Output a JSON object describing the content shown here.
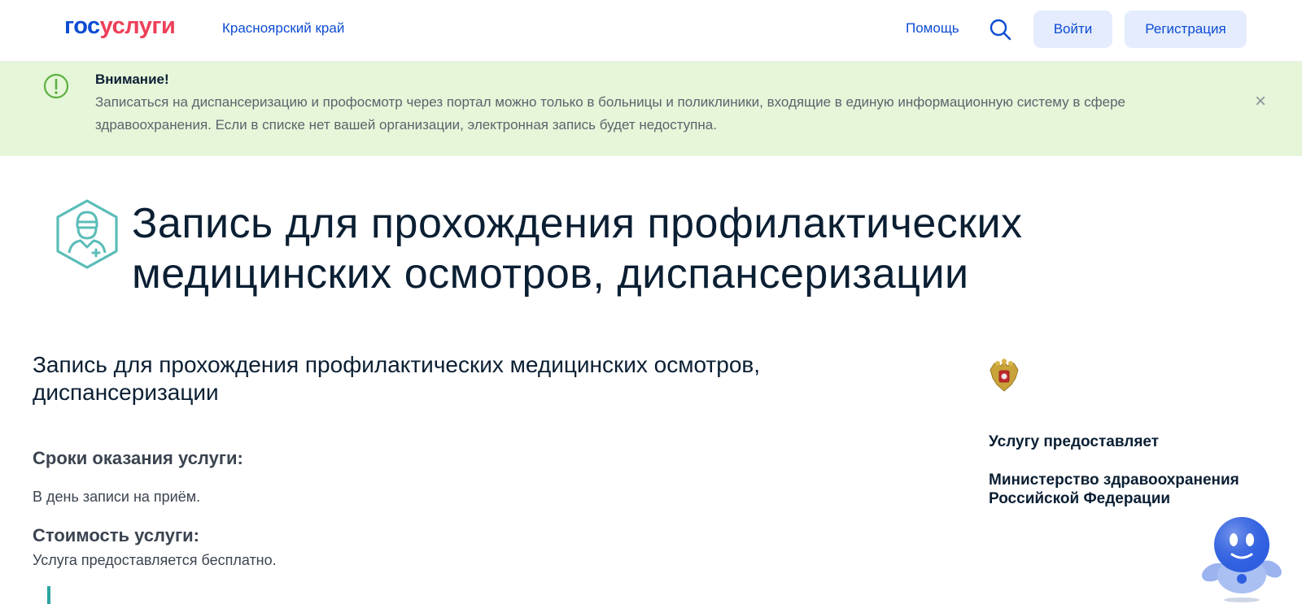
{
  "header": {
    "logo_part1": "гос",
    "logo_part2": "услуги",
    "region": "Красноярский край",
    "help": "Помощь",
    "login": "Войти",
    "register": "Регистрация",
    "search_icon": "search-icon"
  },
  "alert": {
    "title": "Внимание!",
    "text": "Записаться на диспансеризацию и профосмотр через портал можно только в больницы и поликлиники, входящие в единую информационную систему в сфере здравоохранения. Если в списке нет вашей организации, электронная запись будет недоступна.",
    "close": "×"
  },
  "page": {
    "title": "Запись для прохождения профилактических медицинских осмотров, диспансеризации"
  },
  "service": {
    "title": "Запись для прохождения профилактических медицинских осмотров, диспансеризации",
    "term_label": "Сроки оказания услуги:",
    "term_value": "В день записи на приём.",
    "cost_label": "Стоимость услуги:",
    "cost_value": "Услуга предоставляется бесплатно."
  },
  "provider": {
    "label": "Услугу предоставляет",
    "name": "Министерство здравоохранения Российской Федерации"
  },
  "colors": {
    "brand_blue": "#0d4cd3",
    "brand_red": "#ee3f58",
    "alert_bg": "#e5f6d9",
    "accent_teal": "#2aa5a0"
  }
}
